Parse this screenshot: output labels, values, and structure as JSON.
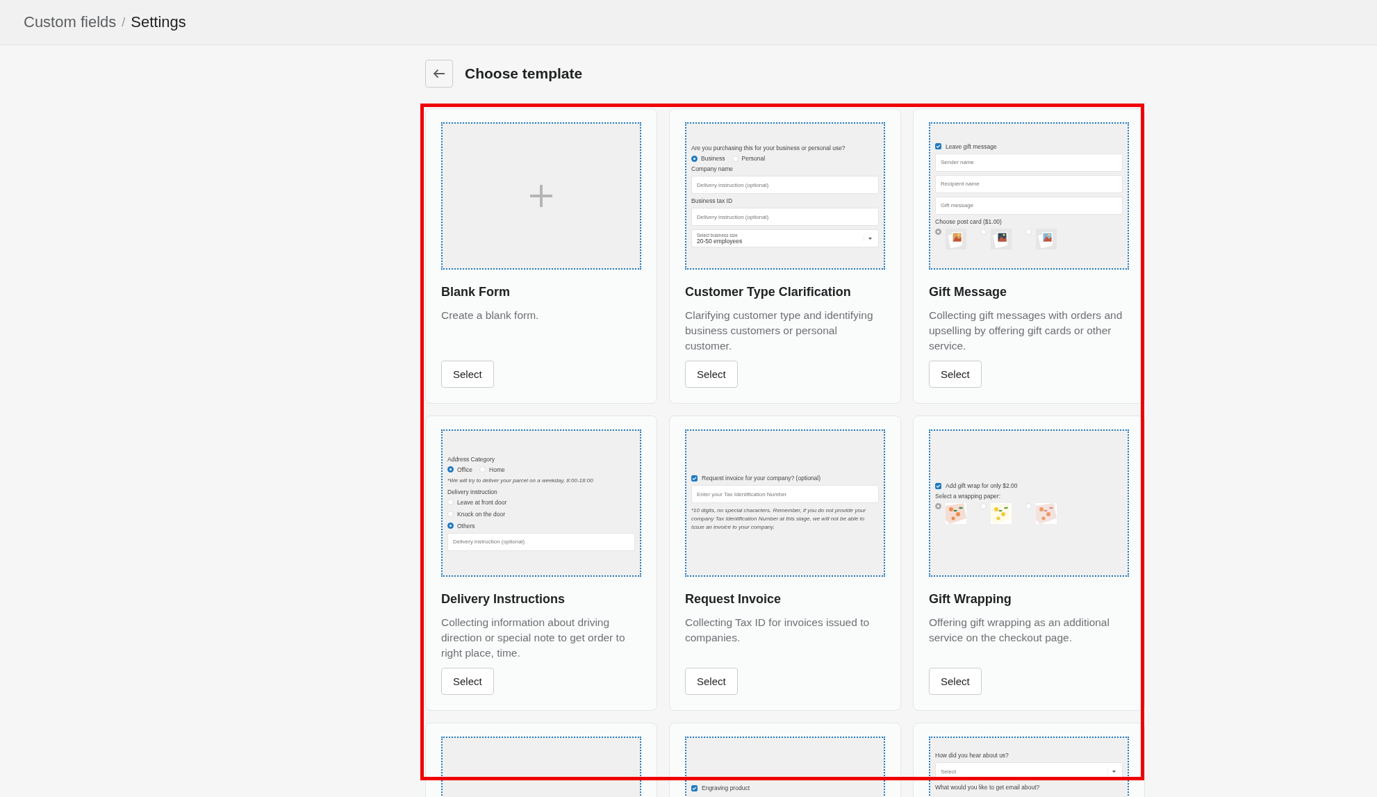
{
  "breadcrumb": {
    "parent": "Custom fields",
    "separator": "/",
    "current": "Settings"
  },
  "page": {
    "title": "Choose template"
  },
  "templates": [
    {
      "title": "Blank Form",
      "description": "Create a blank form.",
      "button": "Select",
      "preview": [
        {
          "kind": "plus"
        }
      ]
    },
    {
      "title": "Customer Type Clarification",
      "description": "Clarifying customer type and identifying business customers or personal customer.",
      "button": "Select",
      "preview": [
        {
          "kind": "label",
          "text": "Are you purchasing this for your business or personal use?"
        },
        {
          "kind": "radio-row",
          "options": [
            {
              "label": "Business",
              "selected": true
            },
            {
              "label": "Personal",
              "selected": false
            }
          ]
        },
        {
          "kind": "label",
          "text": "Company name"
        },
        {
          "kind": "input",
          "placeholder": "Delivery instruction (optional)"
        },
        {
          "kind": "label",
          "text": "Business tax ID"
        },
        {
          "kind": "input",
          "placeholder": "Delivery instruction (optional)"
        },
        {
          "kind": "select",
          "label": "Select business size",
          "value": "20-50 employees"
        }
      ]
    },
    {
      "title": "Gift Message",
      "description": "Collecting gift messages with orders and upselling by offering gift cards or other service.",
      "button": "Select",
      "preview": [
        {
          "kind": "checkbox",
          "label": "Leave gift message",
          "checked": true
        },
        {
          "kind": "input",
          "placeholder": "Sender name"
        },
        {
          "kind": "input",
          "placeholder": "Recipient name"
        },
        {
          "kind": "input",
          "placeholder": "Gift message"
        },
        {
          "kind": "label",
          "text": "Choose post card ($1.00)"
        },
        {
          "kind": "postcard-choices",
          "options": [
            {
              "selected": true
            },
            {
              "selected": false
            },
            {
              "selected": false
            }
          ]
        }
      ]
    },
    {
      "title": "Delivery Instructions",
      "description": "Collecting information about driving direction or special note to get order to right place, time.",
      "button": "Select",
      "preview": [
        {
          "kind": "label",
          "text": "Address Category"
        },
        {
          "kind": "radio-row",
          "options": [
            {
              "label": "Office",
              "selected": true
            },
            {
              "label": "Home",
              "selected": false
            }
          ]
        },
        {
          "kind": "note",
          "text": "*We will try to deliver your parcel on a weekday, 8:00-18:00"
        },
        {
          "kind": "label",
          "text": "Delivery instruction"
        },
        {
          "kind": "radio-column",
          "options": [
            {
              "label": "Leave at front door",
              "selected": false
            },
            {
              "label": "Knock on the door",
              "selected": false
            },
            {
              "label": "Others",
              "selected": true
            }
          ]
        },
        {
          "kind": "input",
          "placeholder": "Delivery instruction (optional)"
        }
      ]
    },
    {
      "title": "Request Invoice",
      "description": "Collecting Tax ID for invoices issued to companies.",
      "button": "Select",
      "preview": [
        {
          "kind": "checkbox",
          "label": "Request invoice for your company? (optional)",
          "checked": true
        },
        {
          "kind": "input",
          "placeholder": "Enter your Tax Identification Number"
        },
        {
          "kind": "note",
          "text": "*10 digits, no special characters. Remember, if you do not provide your company Tax Identification Number at this stage, we will not be able to issue an invoice to your company."
        }
      ]
    },
    {
      "title": "Gift Wrapping",
      "description": "Offering gift wrapping as an additional service on the checkout page.",
      "button": "Select",
      "preview": [
        {
          "kind": "checkbox",
          "label": "Add gift wrap for only $2.00",
          "checked": true
        },
        {
          "kind": "label",
          "text": "Select a wrapping paper:"
        },
        {
          "kind": "paper-choices",
          "options": [
            {
              "selected": true
            },
            {
              "selected": false
            },
            {
              "selected": false
            }
          ]
        }
      ]
    },
    {
      "kind": "cut"
    },
    {
      "kind": "cut",
      "preview": [
        {
          "kind": "spacer"
        },
        {
          "kind": "checkbox",
          "label": "Engraving product",
          "checked": true
        }
      ]
    },
    {
      "kind": "cut",
      "preview": [
        {
          "kind": "label",
          "text": "How did you hear about us?"
        },
        {
          "kind": "select",
          "value": "Select"
        },
        {
          "kind": "label",
          "text": "What would you like to get email about?"
        }
      ]
    }
  ]
}
